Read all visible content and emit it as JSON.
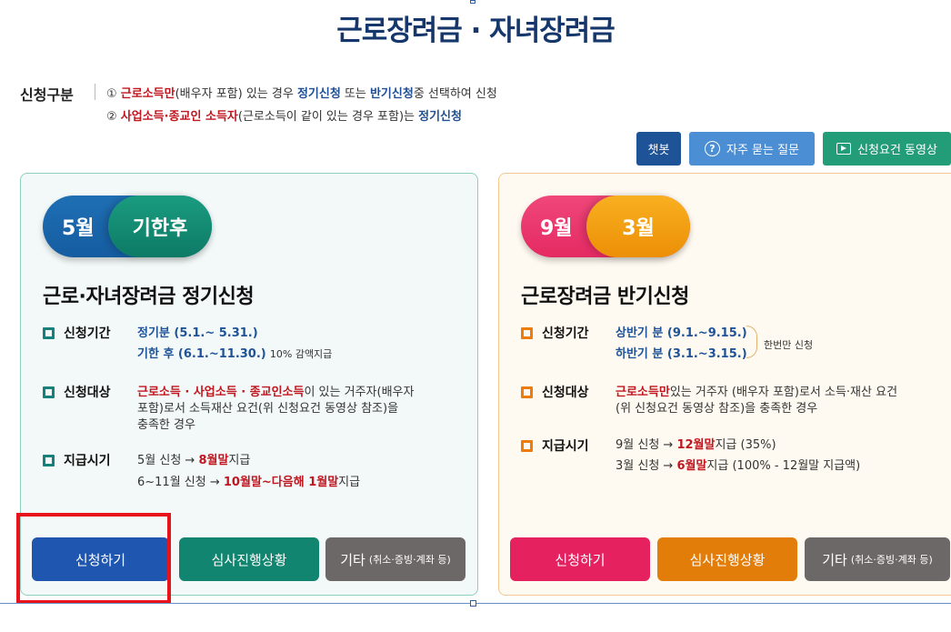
{
  "page": {
    "title": "근로장려금 · 자녀장려금"
  },
  "apply_type": {
    "label": "신청구분",
    "rule1": {
      "num": "①",
      "red": "근로소득만",
      "t1": "(배우자 포함) 있는 경우 ",
      "blue1": "정기신청",
      "t2": " 또는 ",
      "blue2": "반기신청",
      "t3": "중 선택하여 신청"
    },
    "rule2": {
      "num": "②",
      "red": "사업소득·종교인 소득자",
      "t1": "(근로소득이 같이 있는 경우 포함)는 ",
      "blue": "정기신청"
    }
  },
  "top_buttons": {
    "chatbot": "챗봇",
    "faq": "자주 묻는 질문",
    "faq_icon": "question-circle-icon",
    "video": "신청요건 동영상",
    "video_icon": "play-icon"
  },
  "regular": {
    "pill_a": "5월",
    "pill_b": "기한후",
    "title": "근로·자녀장려금 정기신청",
    "period_label": "신청기간",
    "period_line1": "정기분 (5.1.~ 5.31.)",
    "period_line2": "기한 후 (6.1.~11.30.)",
    "period_note": "10% 감액지급",
    "target_label": "신청대상",
    "target_red": "근로소득 · 사업소득 · 종교인소득",
    "target_text1": "이 있는 거주자(배우자",
    "target_text2": "포함)로서 소득재산 요건(위 신청요건 동영상 참조)을",
    "target_text3": "충족한 경우",
    "pay_label": "지급시기",
    "pay1_a": "5월 신청 → ",
    "pay1_red": "8월말",
    "pay1_b": "지급",
    "pay2_a": "6~11월 신청 → ",
    "pay2_red1": "10월말~다음해 1월말",
    "pay2_b": "지급",
    "btn_apply": "신청하기",
    "btn_status": "심사진행상황",
    "btn_etc": "기타",
    "btn_etc_sub": "(취소·증빙·계좌 등)",
    "colors": {
      "apply": "#1f56b0",
      "status": "#11856f",
      "etc": "#6c6867"
    }
  },
  "half": {
    "pill_a": "9월",
    "pill_b": "3월",
    "title": "근로장려금 반기신청",
    "period_label": "신청기간",
    "period_line1": "상반기 분 (9.1.~9.15.)",
    "period_line2": "하반기 분 (3.1.~3.15.)",
    "period_note": "한번만 신청",
    "target_label": "신청대상",
    "target_red": "근로소득만",
    "target_text1": "있는 거주자 (배우자 포함)로서 소득·재산 요건",
    "target_text2": "(위 신청요건 동영상 참조)을 충족한 경우",
    "pay_label": "지급시기",
    "pay1_a": "9월 신청 → ",
    "pay1_red": "12월말",
    "pay1_b": "지급 (35%)",
    "pay2_a": "3월 신청 → ",
    "pay2_red": "6월말",
    "pay2_b": "지급 (100% - 12월말 지급액)",
    "btn_apply": "신청하기",
    "btn_status": "심사진행상황",
    "btn_etc": "기타",
    "btn_etc_sub": "(취소·증빙·계좌 등)",
    "colors": {
      "apply": "#e5215f",
      "status": "#e37d09",
      "etc": "#6c6867"
    }
  }
}
